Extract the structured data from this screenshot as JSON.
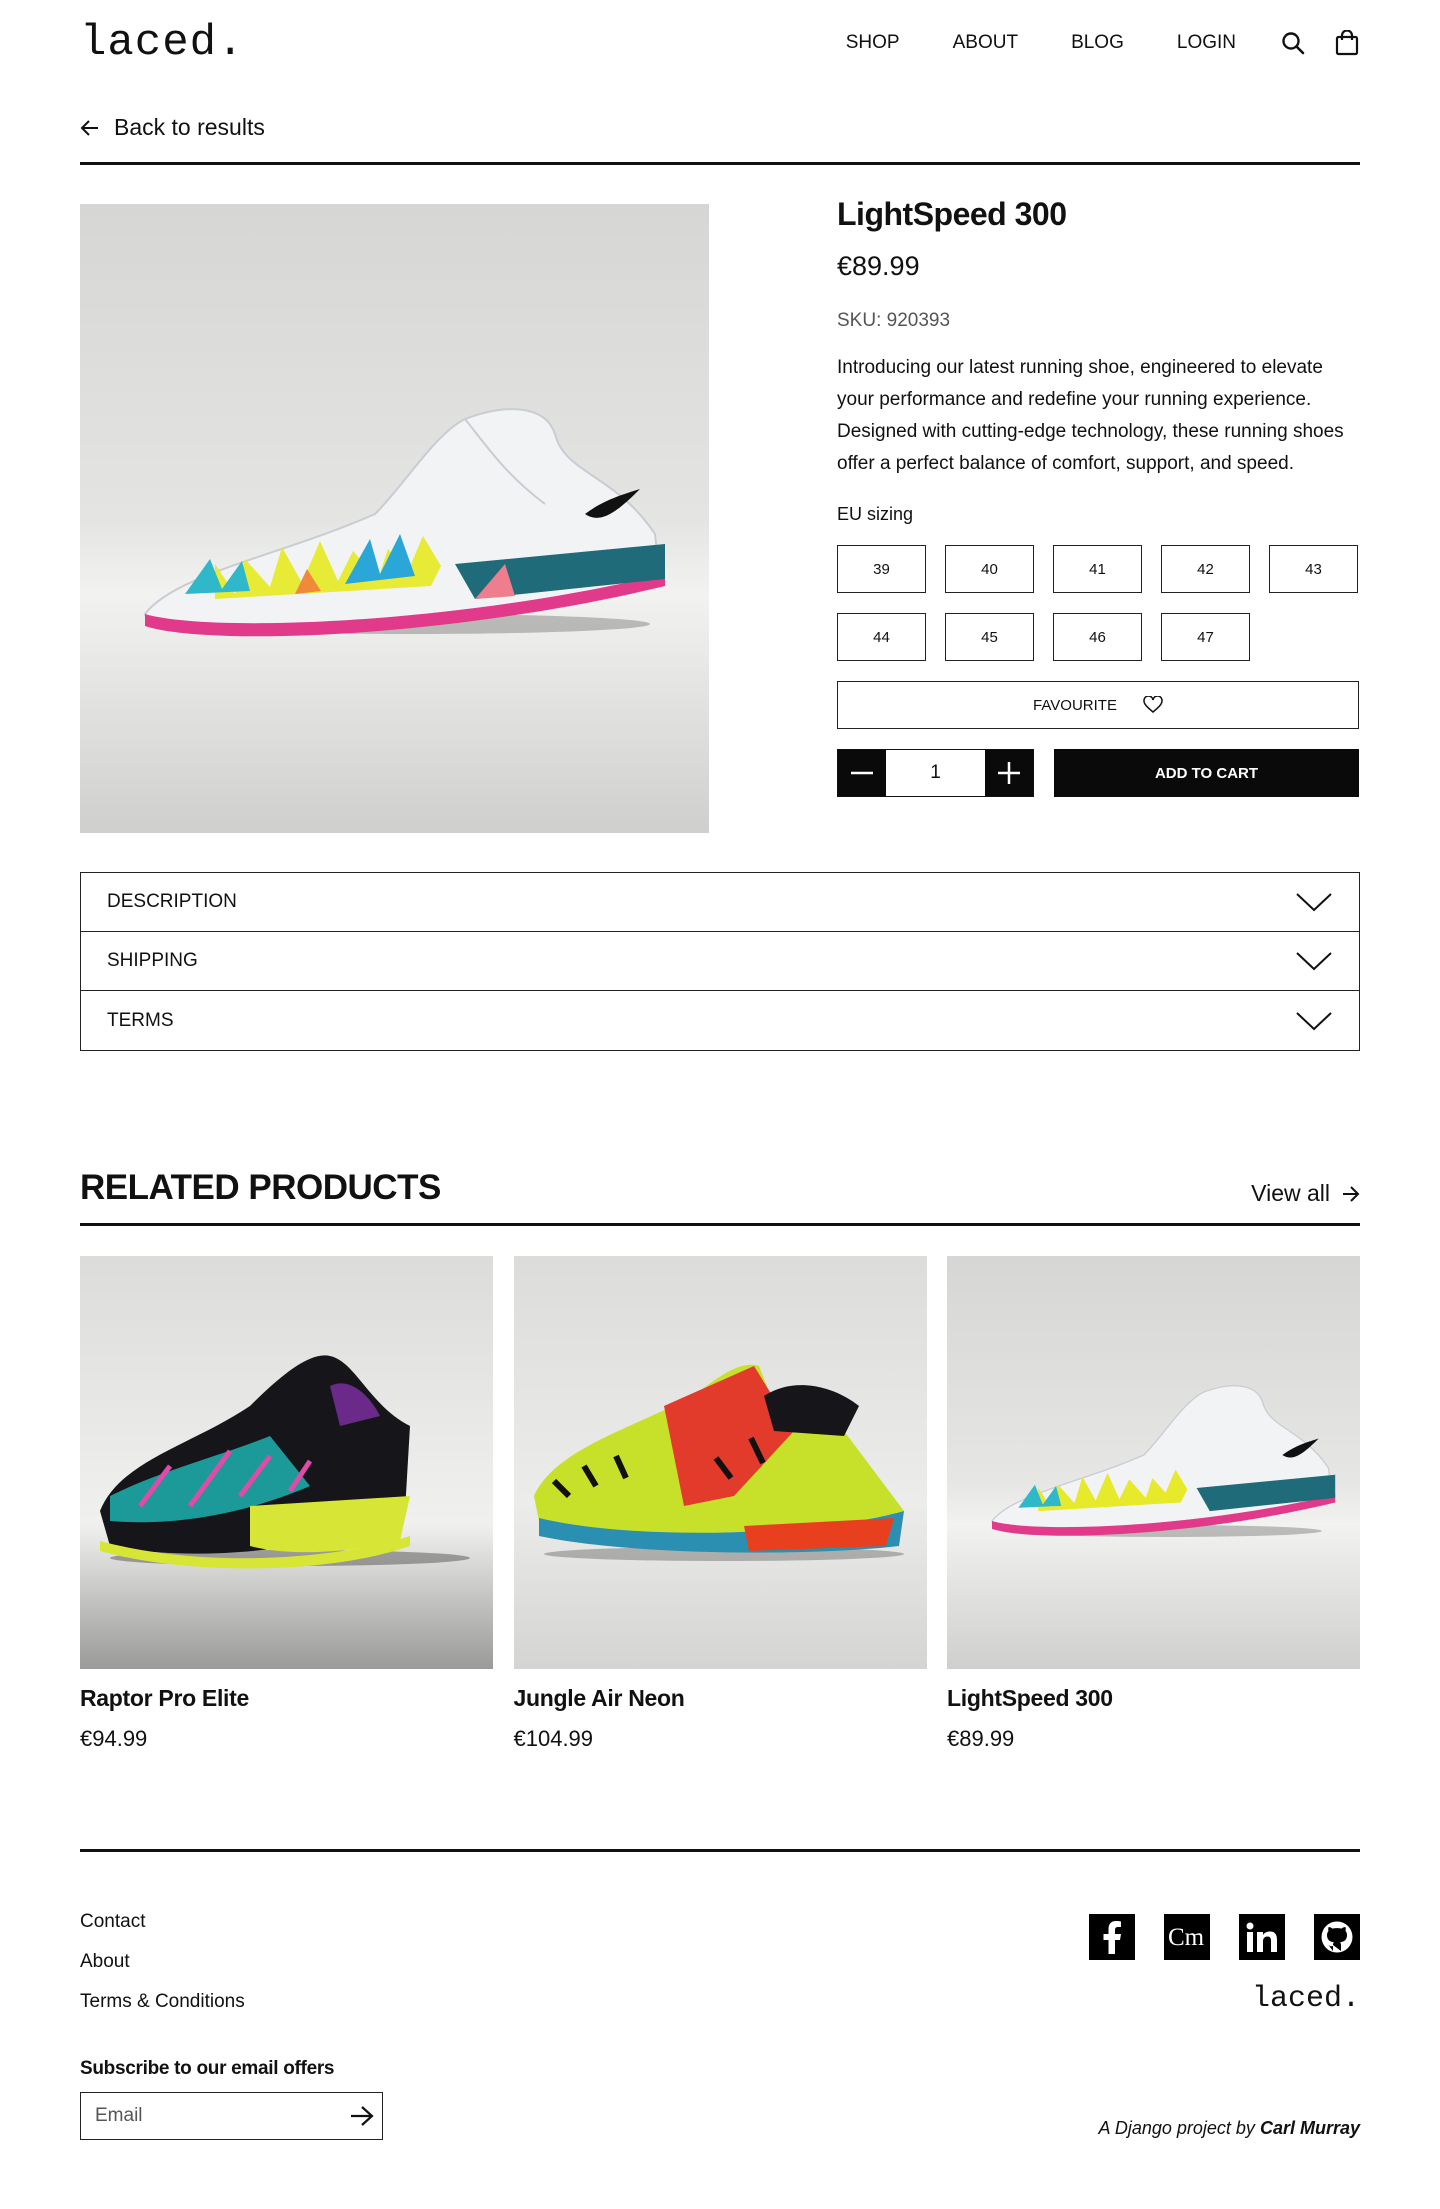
{
  "header": {
    "logo": "laced.",
    "nav": [
      "SHOP",
      "ABOUT",
      "BLOG",
      "LOGIN"
    ],
    "icons": [
      "search-icon",
      "shopping-bag-icon"
    ]
  },
  "back_link": "Back to results",
  "product": {
    "name": "LightSpeed 300",
    "price": "€89.99",
    "sku": "SKU: 920393",
    "description": "Introducing our latest running shoe, engineered to elevate your performance and redefine your running experience. Designed with cutting-edge technology, these running shoes offer a perfect balance of comfort, support, and speed.",
    "sizing_label": "EU sizing",
    "sizes": [
      "39",
      "40",
      "41",
      "42",
      "43",
      "44",
      "45",
      "46",
      "47"
    ],
    "favourite_label": "FAVOURITE",
    "quantity": "1",
    "add_to_cart_label": "ADD TO CART"
  },
  "accordion": [
    "DESCRIPTION",
    "SHIPPING",
    "TERMS"
  ],
  "related": {
    "title": "RELATED PRODUCTS",
    "view_all": "View all",
    "items": [
      {
        "name": "Raptor Pro Elite",
        "price": "€94.99"
      },
      {
        "name": "Jungle Air Neon",
        "price": "€104.99"
      },
      {
        "name": "LightSpeed 300",
        "price": "€89.99"
      }
    ]
  },
  "footer": {
    "links": [
      "Contact",
      "About",
      "Terms & Conditions"
    ],
    "subscribe_label": "Subscribe to our email offers",
    "email_placeholder": "Email",
    "socials": [
      "facebook-icon",
      "cm-icon",
      "linkedin-icon",
      "github-icon"
    ],
    "logo": "laced.",
    "credit_prefix": "A Django project by",
    "credit_name": "Carl Murray"
  },
  "colors": {
    "text": "#111111",
    "button_bg": "#0a0a0a",
    "product_bg": "#d8d8d6"
  }
}
